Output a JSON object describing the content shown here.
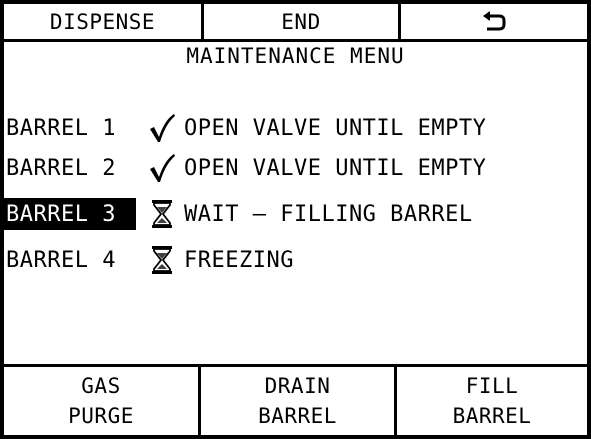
{
  "top_buttons": {
    "dispense": "DISPENSE",
    "end": "END",
    "back_icon": "undo-arrow-icon"
  },
  "title": "MAINTENANCE MENU",
  "barrels": [
    {
      "label": "BARREL 1",
      "icon": "check-icon",
      "status": "OPEN VALVE UNTIL EMPTY",
      "selected": false
    },
    {
      "label": "BARREL 2",
      "icon": "check-icon",
      "status": "OPEN VALVE UNTIL EMPTY",
      "selected": false
    },
    {
      "label": "BARREL 3",
      "icon": "hourglass-icon",
      "status": "WAIT – FILLING BARREL",
      "selected": true
    },
    {
      "label": "BARREL 4",
      "icon": "hourglass-icon",
      "status": "FREEZING",
      "selected": false
    }
  ],
  "bottom_buttons": {
    "gas_purge": {
      "line1": "GAS",
      "line2": "PURGE"
    },
    "drain_barrel": {
      "line1": "DRAIN",
      "line2": "BARREL"
    },
    "fill_barrel": {
      "line1": "FILL",
      "line2": "BARREL"
    }
  }
}
